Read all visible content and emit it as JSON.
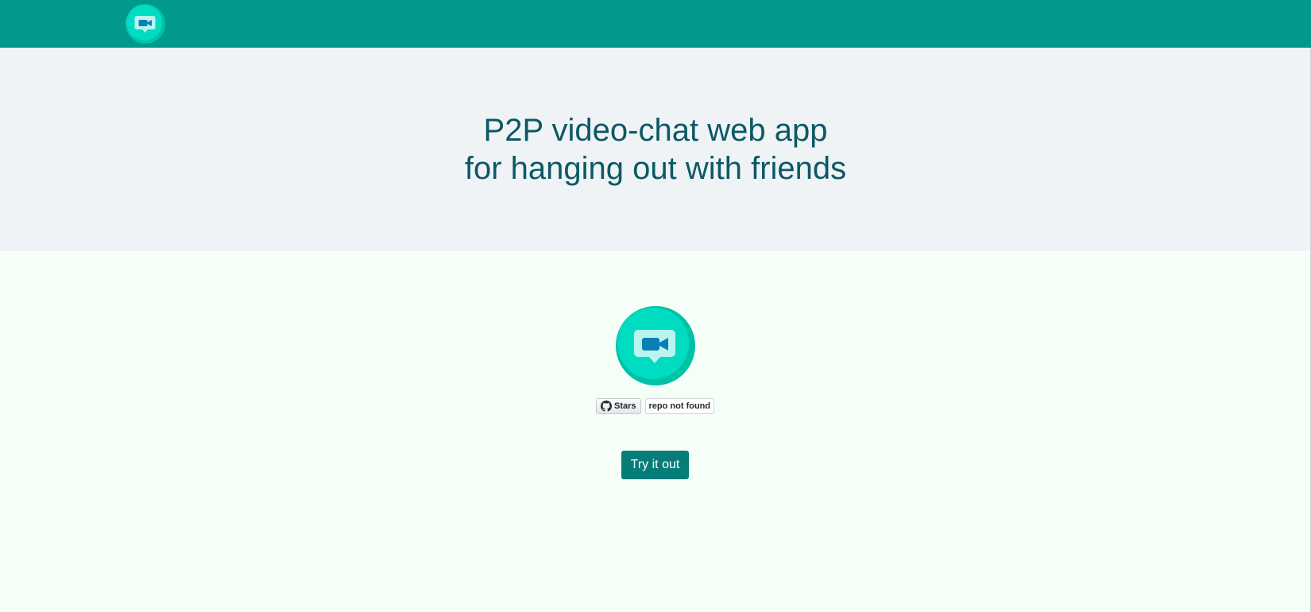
{
  "navbar": {
    "logo_icon": "video-chat-logo-icon",
    "background_color": "#00998b"
  },
  "hero": {
    "title_line1": "P2P video-chat web app",
    "title_line2": "for hanging out with friends",
    "background_color": "#eff3f6",
    "text_color": "#0d5866"
  },
  "main": {
    "logo_icon": "video-chat-logo-icon",
    "github": {
      "icon": "github-icon",
      "button_label": "Stars",
      "count_label": "repo not found"
    },
    "try_button_label": "Try it out",
    "try_button_color": "#077d79",
    "background_color": "#f6fef8"
  }
}
